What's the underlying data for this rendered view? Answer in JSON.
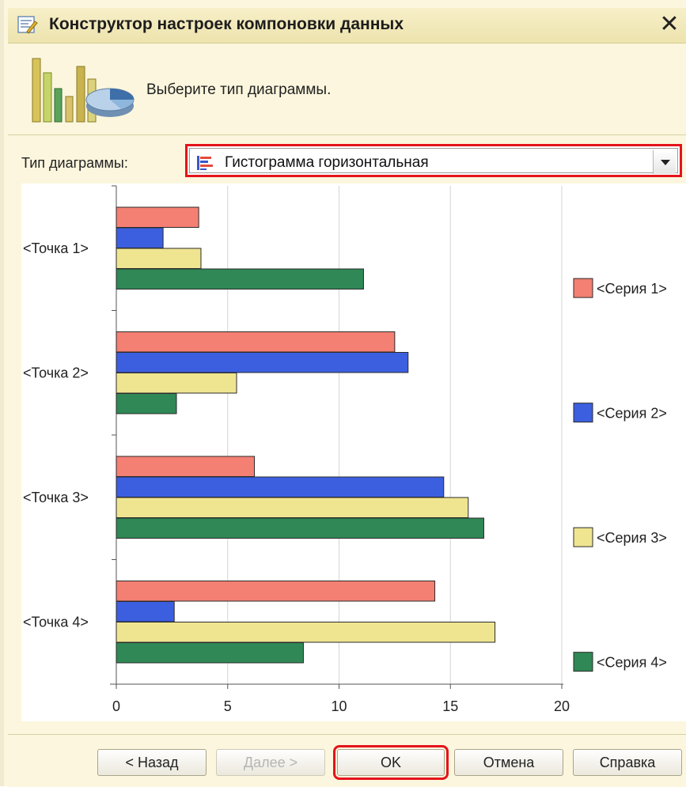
{
  "window": {
    "title": "Конструктор настроек компоновки данных",
    "close_symbol": "✕",
    "icon": "settings-wizard-icon"
  },
  "header": {
    "prompt": "Выберите тип диаграммы.",
    "icon": "chart-types-icon"
  },
  "chart_type": {
    "label": "Тип диаграммы:",
    "value": "Гистограмма горизонтальная",
    "icon": "horizontal-bar-chart-icon"
  },
  "chart_data": {
    "type": "bar",
    "orientation": "horizontal",
    "categories": [
      "<Точка 1>",
      "<Точка 2>",
      "<Точка 3>",
      "<Точка 4>"
    ],
    "series": [
      {
        "name": "<Серия 1>",
        "color": "#f47f73",
        "values": [
          3.7,
          12.5,
          6.2,
          14.3
        ]
      },
      {
        "name": "<Серия 2>",
        "color": "#3c5fe0",
        "values": [
          2.1,
          13.1,
          14.7,
          2.6
        ]
      },
      {
        "name": "<Серия 3>",
        "color": "#efe591",
        "values": [
          3.8,
          5.4,
          15.8,
          17.0
        ]
      },
      {
        "name": "<Серия 4>",
        "color": "#2f8855",
        "values": [
          11.1,
          2.7,
          16.5,
          8.4
        ]
      }
    ],
    "xlim": [
      0,
      20
    ],
    "xticks": [
      0,
      5,
      10,
      15,
      20
    ],
    "grid": true,
    "legend": "right"
  },
  "buttons": {
    "back": "< Назад",
    "next": "Далее >",
    "ok": "OK",
    "cancel": "Отмена",
    "help": "Справка"
  }
}
